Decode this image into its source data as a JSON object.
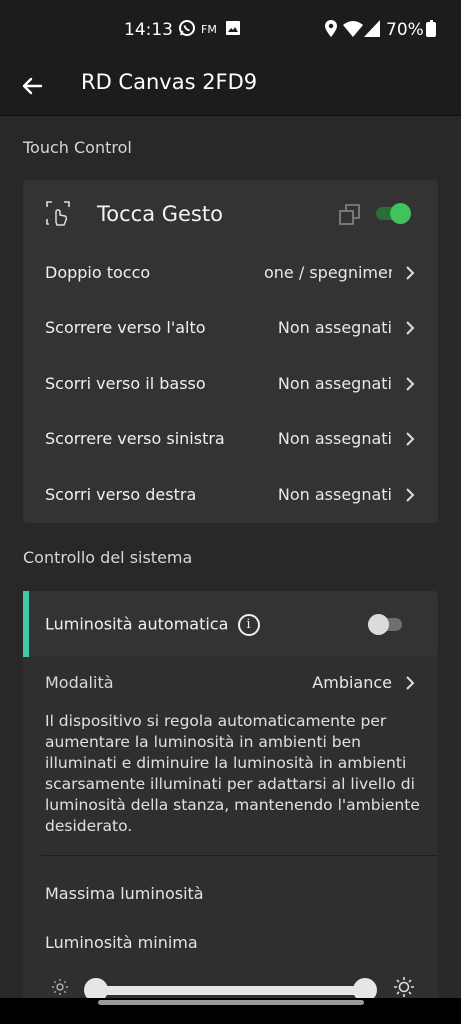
{
  "status_bar": {
    "time": "14:13",
    "battery": "70%",
    "fm": "FM"
  },
  "header": {
    "title": "RD Canvas 2FD9"
  },
  "touch_section": {
    "title": "Touch Control",
    "gesture_card": {
      "title": "Tocca Gesto",
      "enabled": true,
      "rows": [
        {
          "label": "Doppio tocco",
          "value": "one / spegnimen"
        },
        {
          "label": "Scorrere verso l'alto",
          "value": "Non assegnati"
        },
        {
          "label": "Scorri verso il basso",
          "value": "Non assegnati"
        },
        {
          "label": "Scorrere verso sinistra",
          "value": "Non assegnati"
        },
        {
          "label": "Scorri verso destra",
          "value": "Non assegnati"
        }
      ]
    }
  },
  "system_section": {
    "title": "Controllo del sistema",
    "auto_brightness": {
      "label": "Luminosità automatica",
      "enabled": false
    },
    "mode": {
      "label": "Modalità",
      "value": "Ambiance"
    },
    "description": "Il dispositivo si regola automaticamente per aumentare la luminosità in ambienti ben illuminati e diminuire la luminosità in ambienti scarsamente illuminati per adattarsi al livello di luminosità della stanza, mantenendo l'ambiente desiderato.",
    "max_brightness": {
      "label": "Massima luminosità"
    },
    "min_brightness": {
      "label": "Luminosità minima"
    }
  },
  "colors": {
    "accent": "#42c9a8",
    "toggle_on": "#3ec45a",
    "background": "#282828",
    "card": "#333333"
  }
}
